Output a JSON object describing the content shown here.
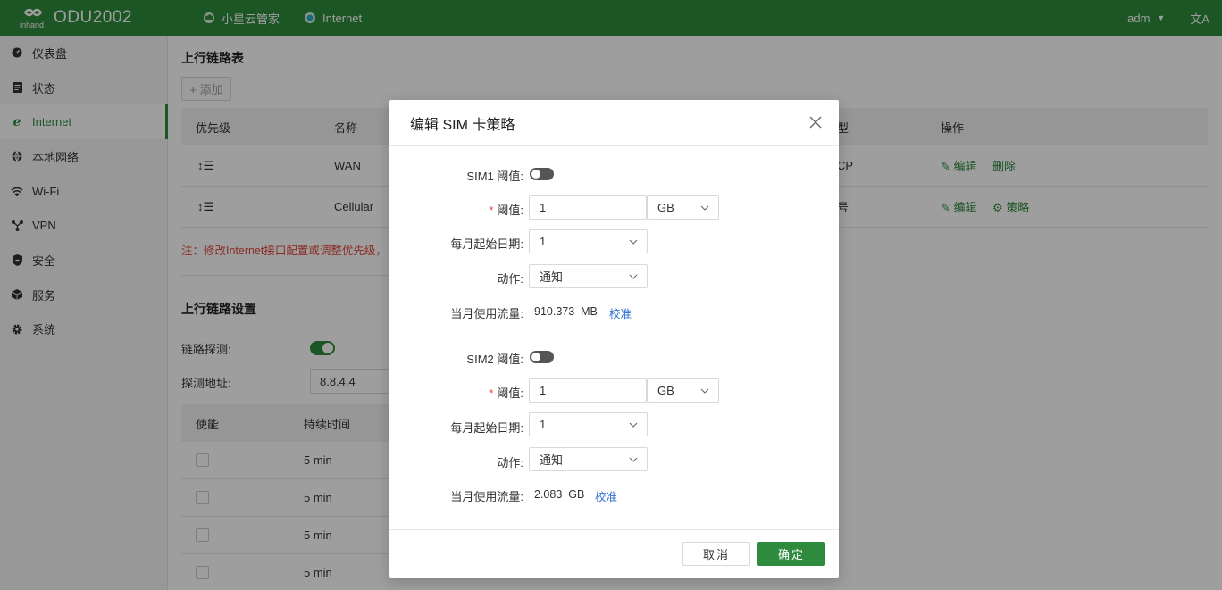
{
  "header": {
    "product": "ODU2002",
    "logo_text": "inhand",
    "items": [
      {
        "label": "小星云管家",
        "icon": "cloud-icon"
      },
      {
        "label": "Internet",
        "icon": "status-dot-icon"
      }
    ],
    "user": "adm",
    "lang_icon": "文A"
  },
  "sidebar": {
    "items": [
      {
        "label": "仪表盘",
        "icon": "dashboard-icon"
      },
      {
        "label": "状态",
        "icon": "status-icon"
      },
      {
        "label": "Internet",
        "icon": "internet-icon"
      },
      {
        "label": "本地网络",
        "icon": "globe-icon"
      },
      {
        "label": "Wi-Fi",
        "icon": "wifi-icon"
      },
      {
        "label": "VPN",
        "icon": "vpn-icon"
      },
      {
        "label": "安全",
        "icon": "shield-icon"
      },
      {
        "label": "服务",
        "icon": "cube-icon"
      },
      {
        "label": "系统",
        "icon": "gear-icon"
      }
    ],
    "active_index": 2
  },
  "main": {
    "uplink_table_title": "上行链路表",
    "add_label": "+ 添加",
    "table": {
      "headers": [
        "优先级",
        "名称",
        "型",
        "操作"
      ],
      "rows": [
        {
          "name": "WAN",
          "type": "CP",
          "actions": [
            "编辑",
            "删除"
          ]
        },
        {
          "name": "Cellular",
          "type": "号",
          "actions": [
            "编辑",
            "策略"
          ]
        }
      ]
    },
    "note": "注：修改Internet接口配置或调整优先级，",
    "uplink_settings_title": "上行链路设置",
    "link_detect_label": "链路探测:",
    "detect_addr_label": "探测地址:",
    "detect_addr_value": "8.8.4.4",
    "detect_table": {
      "headers": [
        "使能",
        "持续时间"
      ],
      "rows": [
        "5 min",
        "5 min",
        "5 min",
        "5 min"
      ]
    }
  },
  "modal": {
    "title": "编辑 SIM 卡策略",
    "sim1": {
      "threshold_toggle_label": "SIM1 阈值:",
      "threshold_label": "阈值:",
      "threshold_value": "1",
      "unit": "GB",
      "start_date_label": "每月起始日期:",
      "start_date_value": "1",
      "action_label": "动作:",
      "action_value": "通知",
      "usage_label": "当月使用流量:",
      "usage_value": "910.373  MB",
      "calibrate": "校准"
    },
    "sim2": {
      "threshold_toggle_label": "SIM2 阈值:",
      "threshold_label": "阈值:",
      "threshold_value": "1",
      "unit": "GB",
      "start_date_label": "每月起始日期:",
      "start_date_value": "1",
      "action_label": "动作:",
      "action_value": "通知",
      "usage_label": "当月使用流量:",
      "usage_value": "2.083  GB",
      "calibrate": "校准"
    },
    "cancel": "取消",
    "ok": "确定"
  },
  "colors": {
    "brand": "#2e8b3d",
    "danger": "#e0463c",
    "link": "#2f6fcf"
  }
}
